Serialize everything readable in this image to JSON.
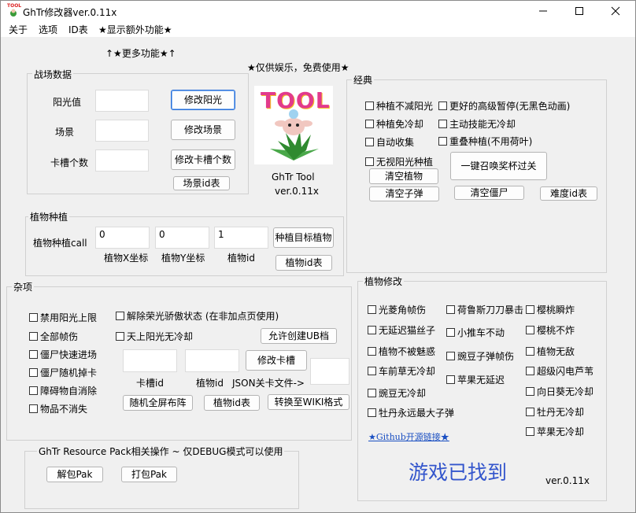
{
  "window": {
    "title": "GhTr修改器ver.0.11x",
    "app_icon_text": "TOOL"
  },
  "menu": [
    "关于",
    "选项",
    "ID表",
    "★显示额外功能★"
  ],
  "hint_more": "↑★更多功能★↑",
  "slogan": "★仅供娱乐，免费使用★",
  "battle": {
    "title": "战场数据",
    "rows": [
      {
        "label": "阳光值",
        "value": "",
        "button": "修改阳光"
      },
      {
        "label": "场景",
        "value": "",
        "button": "修改场景"
      },
      {
        "label": "卡槽个数",
        "value": "",
        "button": "修改卡槽个数"
      }
    ],
    "scene_id_button": "场景id表"
  },
  "logo": {
    "text": "TOOL",
    "name": "GhTr Tool",
    "version": "ver.0.11x"
  },
  "plant_spawn": {
    "title": "植物种植",
    "call_label": "植物种植call",
    "x_value": "0",
    "x_label": "植物X坐标",
    "y_value": "0",
    "y_label": "植物Y坐标",
    "id_value": "1",
    "id_label": "植物id",
    "plant_button": "种植目标植物",
    "id_table_button": "植物id表"
  },
  "misc": {
    "title": "杂项",
    "checks_left": [
      "禁用阳光上限",
      "全部帧伤",
      "僵尸快速进场",
      "僵尸随机掉卡",
      "障碍物自消除",
      "物品不消失"
    ],
    "check_disable_glory": "解除荣光骄傲状态 (在非加点页使用)",
    "check_sky_sun": "天上阳光无冷却",
    "allow_ub_button": "允许创建UB档",
    "slot_id_value": "",
    "slot_id_label": "卡槽id",
    "plant_id_value": "",
    "plant_id_label": "植物id",
    "modify_card_button": "修改卡槽",
    "json_label": "JSON关卡文件->",
    "json_value": "",
    "random_array_button": "随机全屏布阵",
    "plant_id_table_button": "植物id表",
    "wiki_button": "转换至WIKI格式"
  },
  "resource": {
    "title": "GhTr Resource Pack相关操作 ~ 仅DEBUG模式可以使用",
    "unpack_button": "解包Pak",
    "pack_button": "打包Pak"
  },
  "classic": {
    "title": "经典",
    "checks": [
      "种植不减阳光",
      "更好的高级暂停(无黑色动画)",
      "种植免冷却",
      "主动技能无冷却",
      "自动收集",
      "重叠种植(不用荷叶)",
      "无视阳光种植"
    ],
    "clear_plants_button": "清空植物",
    "summon_cup_button": "一键召唤奖杯过关",
    "clear_bullets_button": "清空子弹",
    "clear_zombies_button": "清空僵尸",
    "difficulty_button": "难度id表"
  },
  "plant_mod": {
    "title": "植物修改",
    "col1": [
      "光菱角帧伤",
      "无延迟猫丝子",
      "植物不被魅惑",
      "车前草无冷却",
      "豌豆无冷却",
      "牡丹永远最大子弹"
    ],
    "col2": [
      "荷鲁斯刀刀暴击",
      "小推车不动",
      "豌豆子弹帧伤",
      "苹果无延迟"
    ],
    "col3": [
      "樱桃瞬炸",
      "樱桃不炸",
      "植物无敌",
      "超级闪电芦苇",
      "向日葵无冷却",
      "牡丹无冷却",
      "苹果无冷却"
    ],
    "github_link": "★Github开源链接★",
    "status": "游戏已找到",
    "version": "ver.0.11x"
  },
  "colors": {
    "accent": "#2a6fd8",
    "status": "#3355cc",
    "link": "#1a4fc2"
  }
}
